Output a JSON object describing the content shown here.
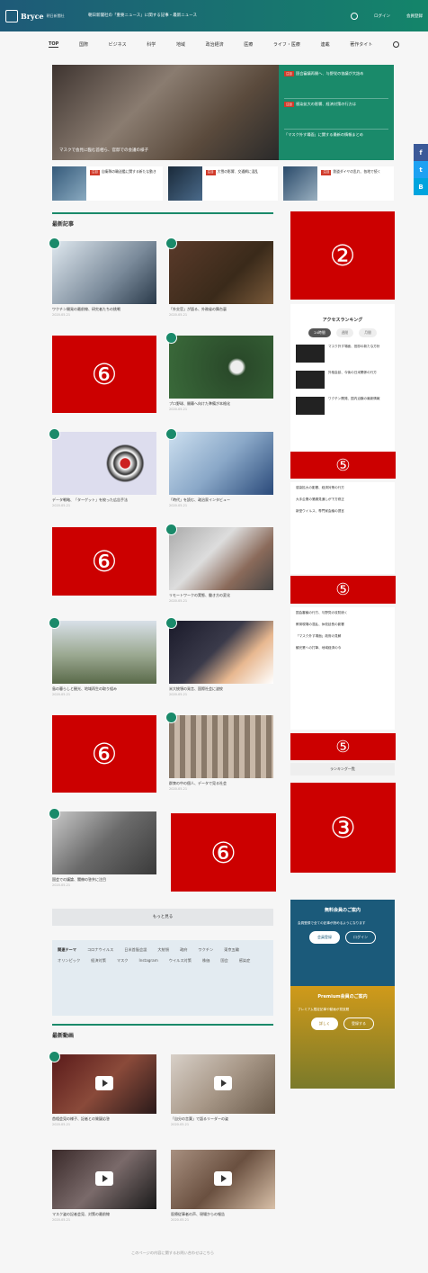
{
  "header": {
    "logo_text": "Bryce",
    "logo_sub": "朝日新聞社",
    "top_news": "朝日新聞社の「重要ニュース」に関する記事・最新ニュース",
    "login": "ログイン",
    "register": "会員登録"
  },
  "nav": [
    "TOP",
    "国際",
    "ビジネス",
    "科学",
    "地域",
    "政治経済",
    "医療",
    "ライフ・医療",
    "連載",
    "著作タイト"
  ],
  "hero": {
    "caption": "マスクで会見に臨む首相ら、官邸での会議の様子",
    "side": [
      {
        "tag": "注目",
        "text": "国会審議再開へ、与野党の協議が大詰め"
      },
      {
        "tag": "注目",
        "text": "感染拡大の影響、経済対策の行方は"
      },
      {
        "tag": "",
        "text": "「マスク外す場面」に関する最新の情報まとめ"
      }
    ]
  },
  "pickups": [
    {
      "tag": "注目",
      "text": "自衛隊の輸送艦に関する新たな動き"
    },
    {
      "tag": "注目",
      "text": "大雪の影響、交通網に混乱"
    },
    {
      "tag": "注目",
      "text": "鉄道ダイヤの乱れ、各地で続く"
    }
  ],
  "sections": {
    "latest": "最新記事",
    "video": "最新動画",
    "more": "もっと見る",
    "ranking_more": "ランキング一覧"
  },
  "cards": [
    {
      "title": "ワクチン開発の最前線、研究者たちの挑戦",
      "meta": "2020.05.21"
    },
    {
      "title": "「外交官」が語る、外務省の舞台裏",
      "meta": "2020.05.21"
    },
    {
      "title": "プロ野球、開幕へ向けた準備が本格化",
      "meta": "2020.05.21"
    },
    {
      "title": "データ戦略、「ターゲット」を絞った広告手法",
      "meta": "2020.05.21"
    },
    {
      "title": "「時代」を読む、政治家インタビュー",
      "meta": "2020.05.21"
    },
    {
      "title": "リモートワークの実態、働き方の変化",
      "meta": "2020.05.21"
    },
    {
      "title": "島の暮らしと観光、地域再生の取り組み",
      "meta": "2020.05.21"
    },
    {
      "title": "米大統領の発言、国際社会に波紋",
      "meta": "2020.05.21"
    },
    {
      "title": "群衆の中の個人、データで見る社会",
      "meta": "2020.05.21"
    },
    {
      "title": "国会での議論、閣僚の答弁に注目",
      "meta": "2020.05.21"
    }
  ],
  "ads": {
    "a2": "②",
    "a3": "③",
    "a5": "⑤",
    "a6": "⑥"
  },
  "ranking": {
    "title": "アクセスランキング",
    "tabs": [
      "24時間",
      "週間",
      "月間"
    ],
    "items": [
      "マスク外す場面、官邸の新たな方針",
      "外相会談、今後の日米関係の行方",
      "ワクチン開発、国内治験の最新情報"
    ],
    "list1": [
      "感染拡大の影響、経済対策の行方",
      "大手企業の業績見通しが下方修正",
      "新型ウイルス、専門家会議の提言"
    ],
    "list2": [
      "国会審議の行方、与野党の攻防続く",
      "教育現場の混乱、休校延長の影響",
      "「マスク外す場面」政府の見解",
      "観光業への打撃、地域経済の今"
    ]
  },
  "member": {
    "free_title": "無料会員のご案内",
    "free_text": "会員登録で全ての記事が読めるようになります",
    "free_btn1": "会員登録",
    "free_btn2": "ログイン",
    "prem_title": "Premium会員のご案内",
    "prem_text": "プレミアム限定記事や動画が見放題",
    "prem_btn1": "詳しく",
    "prem_btn2": "登録する"
  },
  "topics": {
    "label": "関連テーマ",
    "items": [
      "コロナウイルス",
      "日米首脳会談",
      "大統領",
      "政府",
      "ワクチン",
      "東京五輪",
      "オリンピック",
      "経済対策",
      "マスク",
      "Instagram",
      "ウイルス対策",
      "株価",
      "国会",
      "感染症"
    ]
  },
  "videos": [
    {
      "title": "首相会見の様子、記者との質疑応答",
      "meta": "2020.05.21"
    },
    {
      "title": "「自分の言葉」で語るリーダーの姿",
      "meta": "2020.05.21"
    },
    {
      "title": "マスク姿の記者会見、対策の最前線",
      "meta": "2020.05.21"
    },
    {
      "title": "医療従事者の声、現場からの報告",
      "meta": "2020.05.21"
    }
  ],
  "footer_note": "このページの内容に関するお問い合わせはこちら"
}
